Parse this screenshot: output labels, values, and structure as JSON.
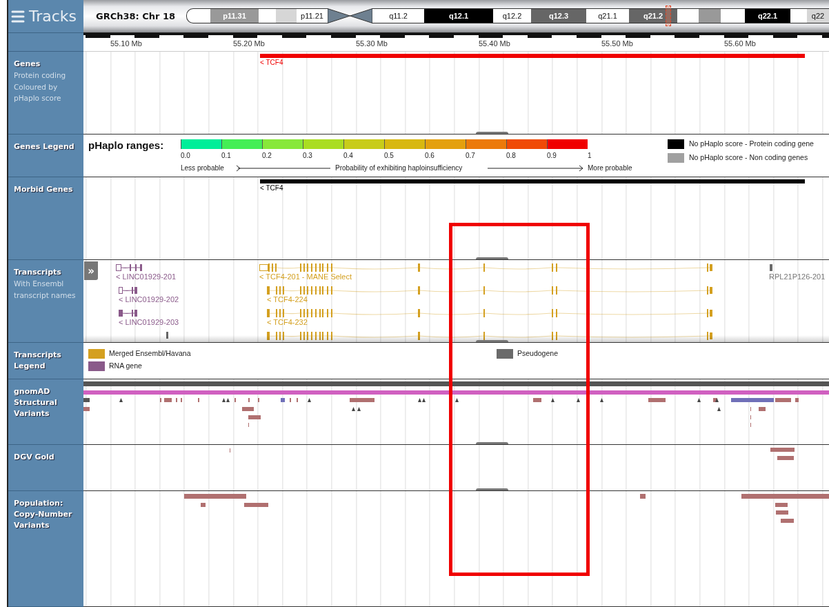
{
  "header": {
    "title": "Tracks",
    "assembly": "GRCh38: Chr 18"
  },
  "ideogram": {
    "bands": [
      {
        "kind": "white"
      },
      {
        "kind": "gray",
        "label": "p11.31"
      },
      {
        "kind": "white"
      },
      {
        "kind": "light"
      },
      {
        "kind": "white",
        "label": "p11.21"
      },
      {
        "kind": "centromere"
      },
      {
        "kind": "white",
        "label": "q11.2"
      },
      {
        "kind": "black",
        "label": "q12.1"
      },
      {
        "kind": "white",
        "label": "q12.2"
      },
      {
        "kind": "dark",
        "label": "q12.3"
      },
      {
        "kind": "white",
        "label": "q21.1"
      },
      {
        "kind": "dark",
        "label": "q21.2"
      },
      {
        "kind": "white"
      },
      {
        "kind": "gray"
      },
      {
        "kind": "white"
      },
      {
        "kind": "black",
        "label": "q22.1"
      },
      {
        "kind": "white"
      },
      {
        "kind": "light",
        "label": "q22"
      }
    ]
  },
  "ruler": {
    "ticks": [
      "55.10 Mb",
      "55.20 Mb",
      "55.30 Mb",
      "55.40 Mb",
      "55.50 Mb",
      "55.60 Mb"
    ]
  },
  "tracks": [
    {
      "kind": "genes",
      "label": "Genes",
      "sublabel": "Protein coding Coloured by pHaplo score",
      "genes": [
        {
          "label": "< TCF4",
          "color": "#f00000"
        }
      ]
    },
    {
      "kind": "genes_legend",
      "label": "Genes Legend",
      "scale": {
        "title": "pHaplo ranges:",
        "segments": [
          {
            "color": "#00ee99"
          },
          {
            "color": "#44ee55"
          },
          {
            "color": "#88e83a"
          },
          {
            "color": "#aadd22"
          },
          {
            "color": "#c8cc1a"
          },
          {
            "color": "#d8b810"
          },
          {
            "color": "#e4a00e"
          },
          {
            "color": "#ec7a0a"
          },
          {
            "color": "#f04a05"
          },
          {
            "color": "#f00000"
          }
        ],
        "ticks": [
          "0.0",
          "0.1",
          "0.2",
          "0.3",
          "0.4",
          "0.5",
          "0.6",
          "0.7",
          "0.8",
          "0.9",
          "1"
        ],
        "left_label": "Less probable",
        "middle_label": "Probability of exhibiting haploinsufficiency",
        "right_label": "More probable"
      },
      "key": [
        {
          "label": "No pHaplo score - Protein coding gene",
          "color": "#000000"
        },
        {
          "label": "No pHaplo score - Non coding genes",
          "color": "#a0a0a0"
        }
      ]
    },
    {
      "kind": "genes",
      "label": "Morbid Genes",
      "genes": [
        {
          "label": "< TCF4",
          "color": "#000000"
        }
      ]
    },
    {
      "kind": "transcripts",
      "label": "Transcripts",
      "sublabel": "With Ensembl transcript names",
      "expand": "»",
      "transcripts": [
        {
          "label": "< LINC01929-201",
          "kind": "rna"
        },
        {
          "label": "< LINC01929-202",
          "kind": "rna"
        },
        {
          "label": "< LINC01929-203",
          "kind": "rna"
        },
        {
          "label": "< TCF4-201 - MANE Select",
          "kind": "merged"
        },
        {
          "label": "< TCF4-224",
          "kind": "merged"
        },
        {
          "label": "< TCF4-232",
          "kind": "merged"
        },
        {
          "label": "RPL21P126-201",
          "kind": "pseudogene"
        }
      ]
    },
    {
      "kind": "transcripts_legend",
      "label": "Transcripts Legend",
      "key": [
        {
          "label": "Merged Ensembl/Havana",
          "kind": "merged"
        },
        {
          "label": "RNA gene",
          "kind": "rna"
        },
        {
          "label": "Pseudogene",
          "kind": "pseudogene"
        }
      ]
    },
    {
      "kind": "gnomad",
      "label": "gnomAD Structural Variants"
    },
    {
      "kind": "dgv",
      "label": "DGV Gold"
    },
    {
      "kind": "population",
      "label": "Population: Copy-Number Variants"
    }
  ]
}
